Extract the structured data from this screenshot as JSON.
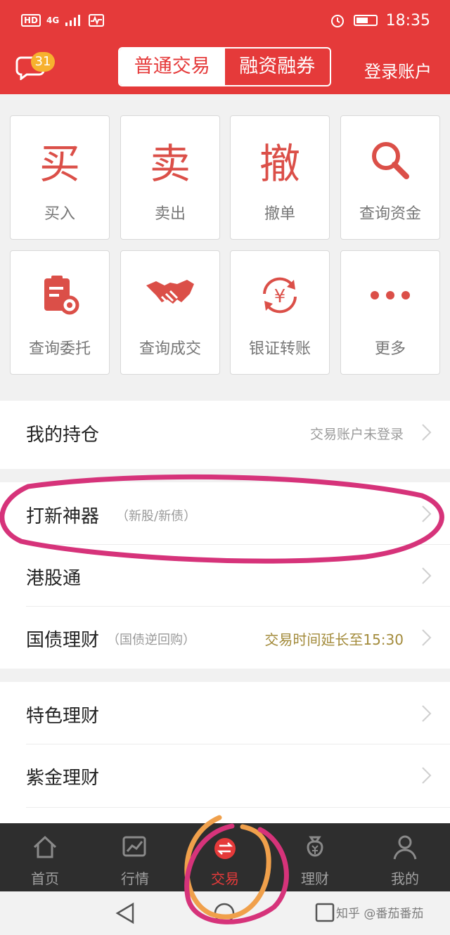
{
  "status_bar": {
    "left_icons": [
      "HD",
      "4G"
    ],
    "time": "18:35"
  },
  "header": {
    "message_badge": "31",
    "segments": [
      "普通交易",
      "融资融券"
    ],
    "login_label": "登录账户"
  },
  "tiles": [
    {
      "glyph": "买",
      "label": "买入"
    },
    {
      "glyph": "卖",
      "label": "卖出"
    },
    {
      "glyph": "撤",
      "label": "撤单"
    },
    {
      "icon": "search-icon",
      "label": "查询资金"
    },
    {
      "icon": "clipboard-search-icon",
      "label": "查询委托"
    },
    {
      "icon": "handshake-icon",
      "label": "查询成交"
    },
    {
      "icon": "yuan-transfer-icon",
      "glyph": "¥",
      "label": "银证转账"
    },
    {
      "icon": "more-icon",
      "label": "更多"
    }
  ],
  "rows": {
    "holdings": {
      "title": "我的持仓",
      "right": "交易账户未登录"
    },
    "ipo": {
      "title": "打新神器",
      "sub": "（新股/新债）"
    },
    "hk": {
      "title": "港股通"
    },
    "bond": {
      "title": "国债理财",
      "sub": "（国债逆回购）",
      "right": "交易时间延长至15:30"
    },
    "special": {
      "title": "特色理财"
    },
    "gold": {
      "title": "紫金理财"
    }
  },
  "tabs": [
    {
      "label": "首页",
      "icon": "home-icon"
    },
    {
      "label": "行情",
      "icon": "chart-icon"
    },
    {
      "label": "交易",
      "icon": "trade-icon",
      "active": true
    },
    {
      "label": "理财",
      "icon": "money-bag-icon"
    },
    {
      "label": "我的",
      "icon": "person-icon"
    }
  ],
  "watermark": "知乎 @番茄番茄",
  "colors": {
    "brand_red": "#e53a3a",
    "badge_orange": "#f7b12f",
    "annotation_magenta": "#d6337a",
    "annotation_orange": "#f0a04b"
  }
}
